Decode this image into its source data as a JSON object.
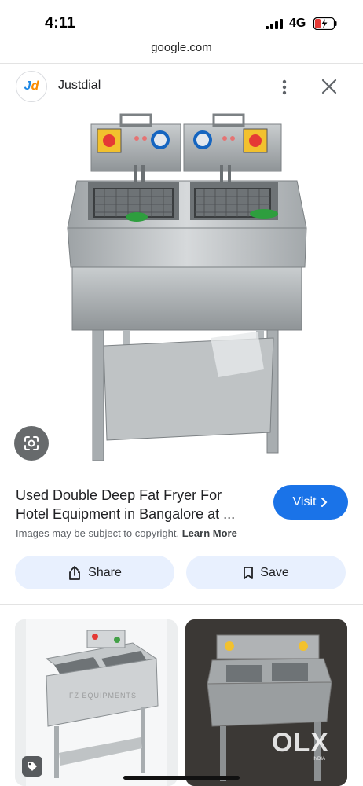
{
  "status_bar": {
    "time": "4:11",
    "network": "4G"
  },
  "browser": {
    "url": "google.com"
  },
  "source": {
    "logo_j": "J",
    "logo_d": "d",
    "name": "Justdial"
  },
  "result": {
    "title_line1": "Used Double Deep Fat Fryer For",
    "title_line2": "Hotel Equipment in Bangalore at ...",
    "visit_label": "Visit",
    "copyright_text": "Images may be subject to copyright.",
    "learn_more": "Learn More"
  },
  "actions": {
    "share_label": "Share",
    "save_label": "Save"
  },
  "related": {
    "card1_watermark": "FZ EQUIPMENTS",
    "card2_watermark": "OLX",
    "card2_watermark_sub": "INDIA"
  },
  "icons": {
    "more": "more-vert-icon",
    "close": "close-icon",
    "lens": "lens-icon",
    "visit_chevron": "chevron-right-icon",
    "share": "share-icon",
    "save": "bookmark-icon",
    "tag": "tag-icon"
  },
  "colors": {
    "accent": "#1a73e8",
    "pill_bg": "#e8f0fe",
    "brand_j": "#1e88e5",
    "brand_d": "#fb8c00"
  }
}
